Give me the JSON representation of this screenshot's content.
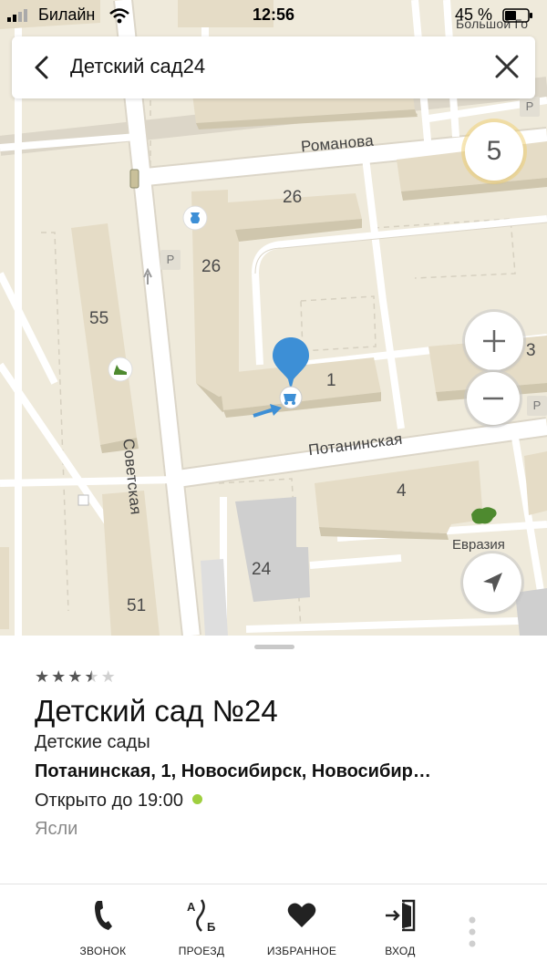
{
  "status_bar": {
    "carrier": "Билайн",
    "time": "12:56",
    "battery": "45 %"
  },
  "search": {
    "query": "Детский сад24"
  },
  "map": {
    "zoom_level": "5",
    "streets": {
      "romanova": "Романова",
      "sovetskaya": "Советская",
      "potaninskaya": "Потанинская",
      "bolshoy": "Большой Го"
    },
    "house_numbers": {
      "h26a": "26",
      "h26b": "26",
      "h55": "55",
      "h1": "1",
      "h3": "3",
      "h4": "4",
      "h24": "24",
      "h51": "51"
    },
    "poi_eurasia": "Евразия",
    "parking_symbol": "P",
    "colors": {
      "background": "#efeadb",
      "building": "#e5dcc6",
      "building_side": "#cfc6ad",
      "road": "#ffffff",
      "pin": "#3d8fd6",
      "poi_green": "#4e8a2f"
    }
  },
  "card": {
    "rating": 3.5,
    "rating_max": 5,
    "title": "Детский сад №24",
    "category": "Детские сады",
    "address": "Потанинская, 1, Новосибирск, Новосибир…",
    "hours": "Открыто до 19:00",
    "hours_status_color": "#9fcf3f",
    "tag": "Ясли"
  },
  "actions": {
    "call": "ЗВОНОК",
    "route": "ПРОЕЗД",
    "favorite": "ИЗБРАННОЕ",
    "entry": "ВХОД"
  },
  "icons": {
    "back": "back-arrow-icon",
    "close": "close-icon",
    "zoom_in": "plus-icon",
    "zoom_out": "minus-icon",
    "locate": "location-arrow-icon",
    "call": "phone-icon",
    "route": "route-ab-icon",
    "favorite": "heart-icon",
    "entry": "entrance-icon",
    "more": "more-vertical-icon"
  }
}
